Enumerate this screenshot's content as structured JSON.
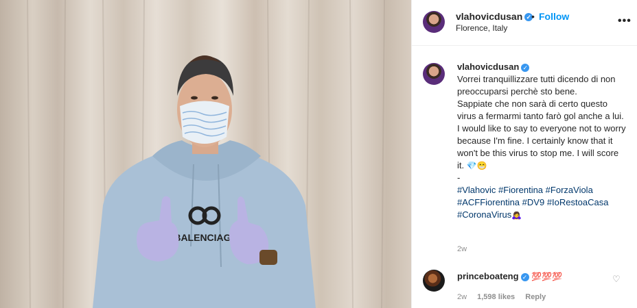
{
  "post": {
    "username": "vlahovicdusan",
    "follow_label": "Follow",
    "separator": "•",
    "location": "Florence, Italy",
    "more_label": "•••",
    "photo_text": "BALENCIAGA"
  },
  "caption": {
    "username": "vlahovicdusan",
    "lines": [
      "Vorrei tranquillizzare tutti dicendo di non preoccuparsi perchè sto bene.",
      "Sappiate che non sarà di certo questo virus a fermarmi tanto farò gol anche a lui.",
      "I would like to say to everyone not to worry because I'm fine. I certainly know that it won't be this virus to stop me. I will score it.",
      "-"
    ],
    "emoji_end": "💎😁",
    "hashtags": {
      "h1": "#Vlahovic",
      "h2": "#Fiorentina",
      "h3": "#ForzaViola",
      "h4": "#ACFFiorentina",
      "h5": "#DV9",
      "h6": "#IoRestoaCasa",
      "h7": "#CoronaVirus"
    },
    "hashtag_emoji": "🙇‍♀️",
    "time": "2w"
  },
  "comment": {
    "username": "princeboateng",
    "text": "💯💯💯",
    "time": "2w",
    "likes": "1,598 likes",
    "reply_label": "Reply"
  },
  "colors": {
    "link": "#00376b",
    "follow": "#0095f6",
    "verified": "#3897f0"
  },
  "icons": {
    "verified": "verified-badge-icon",
    "heart": "heart-icon",
    "more": "more-options-icon"
  }
}
